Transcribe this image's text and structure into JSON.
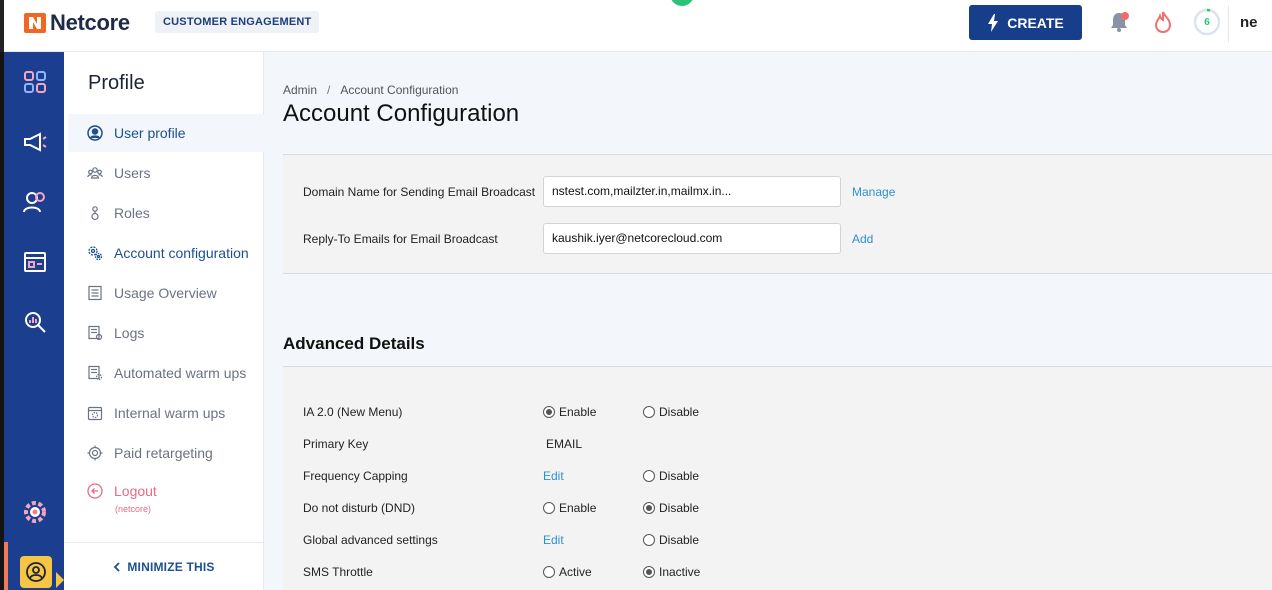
{
  "header": {
    "brand": "Netcore",
    "product_badge": "CUSTOMER ENGAGEMENT",
    "create_label": "CREATE",
    "progress_count": "6",
    "user_label": "ne"
  },
  "sidebar": {
    "title": "Profile",
    "items": [
      {
        "label": "User profile"
      },
      {
        "label": "Users"
      },
      {
        "label": "Roles"
      },
      {
        "label": "Account configuration"
      },
      {
        "label": "Usage Overview"
      },
      {
        "label": "Logs"
      },
      {
        "label": "Automated warm ups"
      },
      {
        "label": "Internal warm ups"
      },
      {
        "label": "Paid retargeting"
      },
      {
        "label": "Logout"
      }
    ],
    "logout_sub": "(netcore)",
    "minimize_label": "MINIMIZE THIS"
  },
  "breadcrumb": {
    "root": "Admin",
    "separator": "/",
    "current": "Account Configuration"
  },
  "page_title": "Account Configuration",
  "email_settings": {
    "domain_label": "Domain Name for Sending Email Broadcast",
    "domain_value": "nstest.com,mailzter.in,mailmx.in...",
    "domain_action": "Manage",
    "reply_label": "Reply-To Emails for Email Broadcast",
    "reply_value": "kaushik.iyer@netcorecloud.com",
    "reply_action": "Add"
  },
  "advanced": {
    "title": "Advanced Details",
    "rows": [
      {
        "label": "IA 2.0 (New Menu)",
        "opt1": "Enable",
        "opt2": "Disable"
      },
      {
        "label": "Primary Key",
        "value": "EMAIL"
      },
      {
        "label": "Frequency Capping",
        "link": "Edit",
        "opt2": "Disable"
      },
      {
        "label": "Do not disturb (DND)",
        "opt1": "Enable",
        "opt2": "Disable"
      },
      {
        "label": "Global advanced settings",
        "link": "Edit",
        "opt2": "Disable"
      },
      {
        "label": "SMS Throttle",
        "opt1": "Active",
        "opt2": "Inactive"
      }
    ]
  },
  "colors": {
    "brand_blue": "#163e8a",
    "rail_blue": "#1c3e8e",
    "link_blue": "#2e8fd0",
    "logout_pink": "#e56a8a"
  }
}
